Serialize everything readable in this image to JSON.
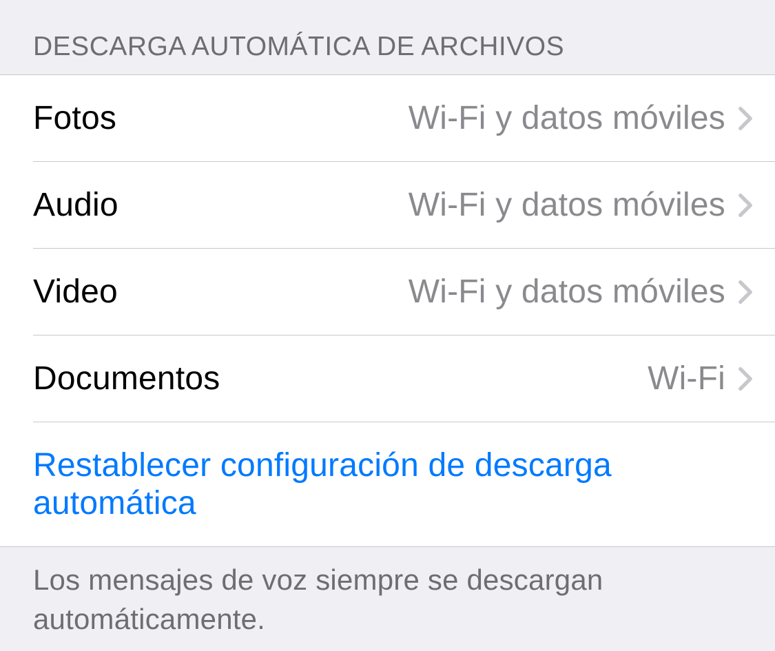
{
  "section": {
    "header": "Descarga automática de archivos",
    "footer": "Los mensajes de voz siempre se descargan automáticamente.",
    "rows": [
      {
        "label": "Fotos",
        "value": "Wi-Fi y datos móviles"
      },
      {
        "label": "Audio",
        "value": "Wi-Fi y datos móviles"
      },
      {
        "label": "Video",
        "value": "Wi-Fi y datos móviles"
      },
      {
        "label": "Documentos",
        "value": "Wi-Fi"
      }
    ],
    "reset_label": "Restablecer configuración de descarga automática"
  }
}
